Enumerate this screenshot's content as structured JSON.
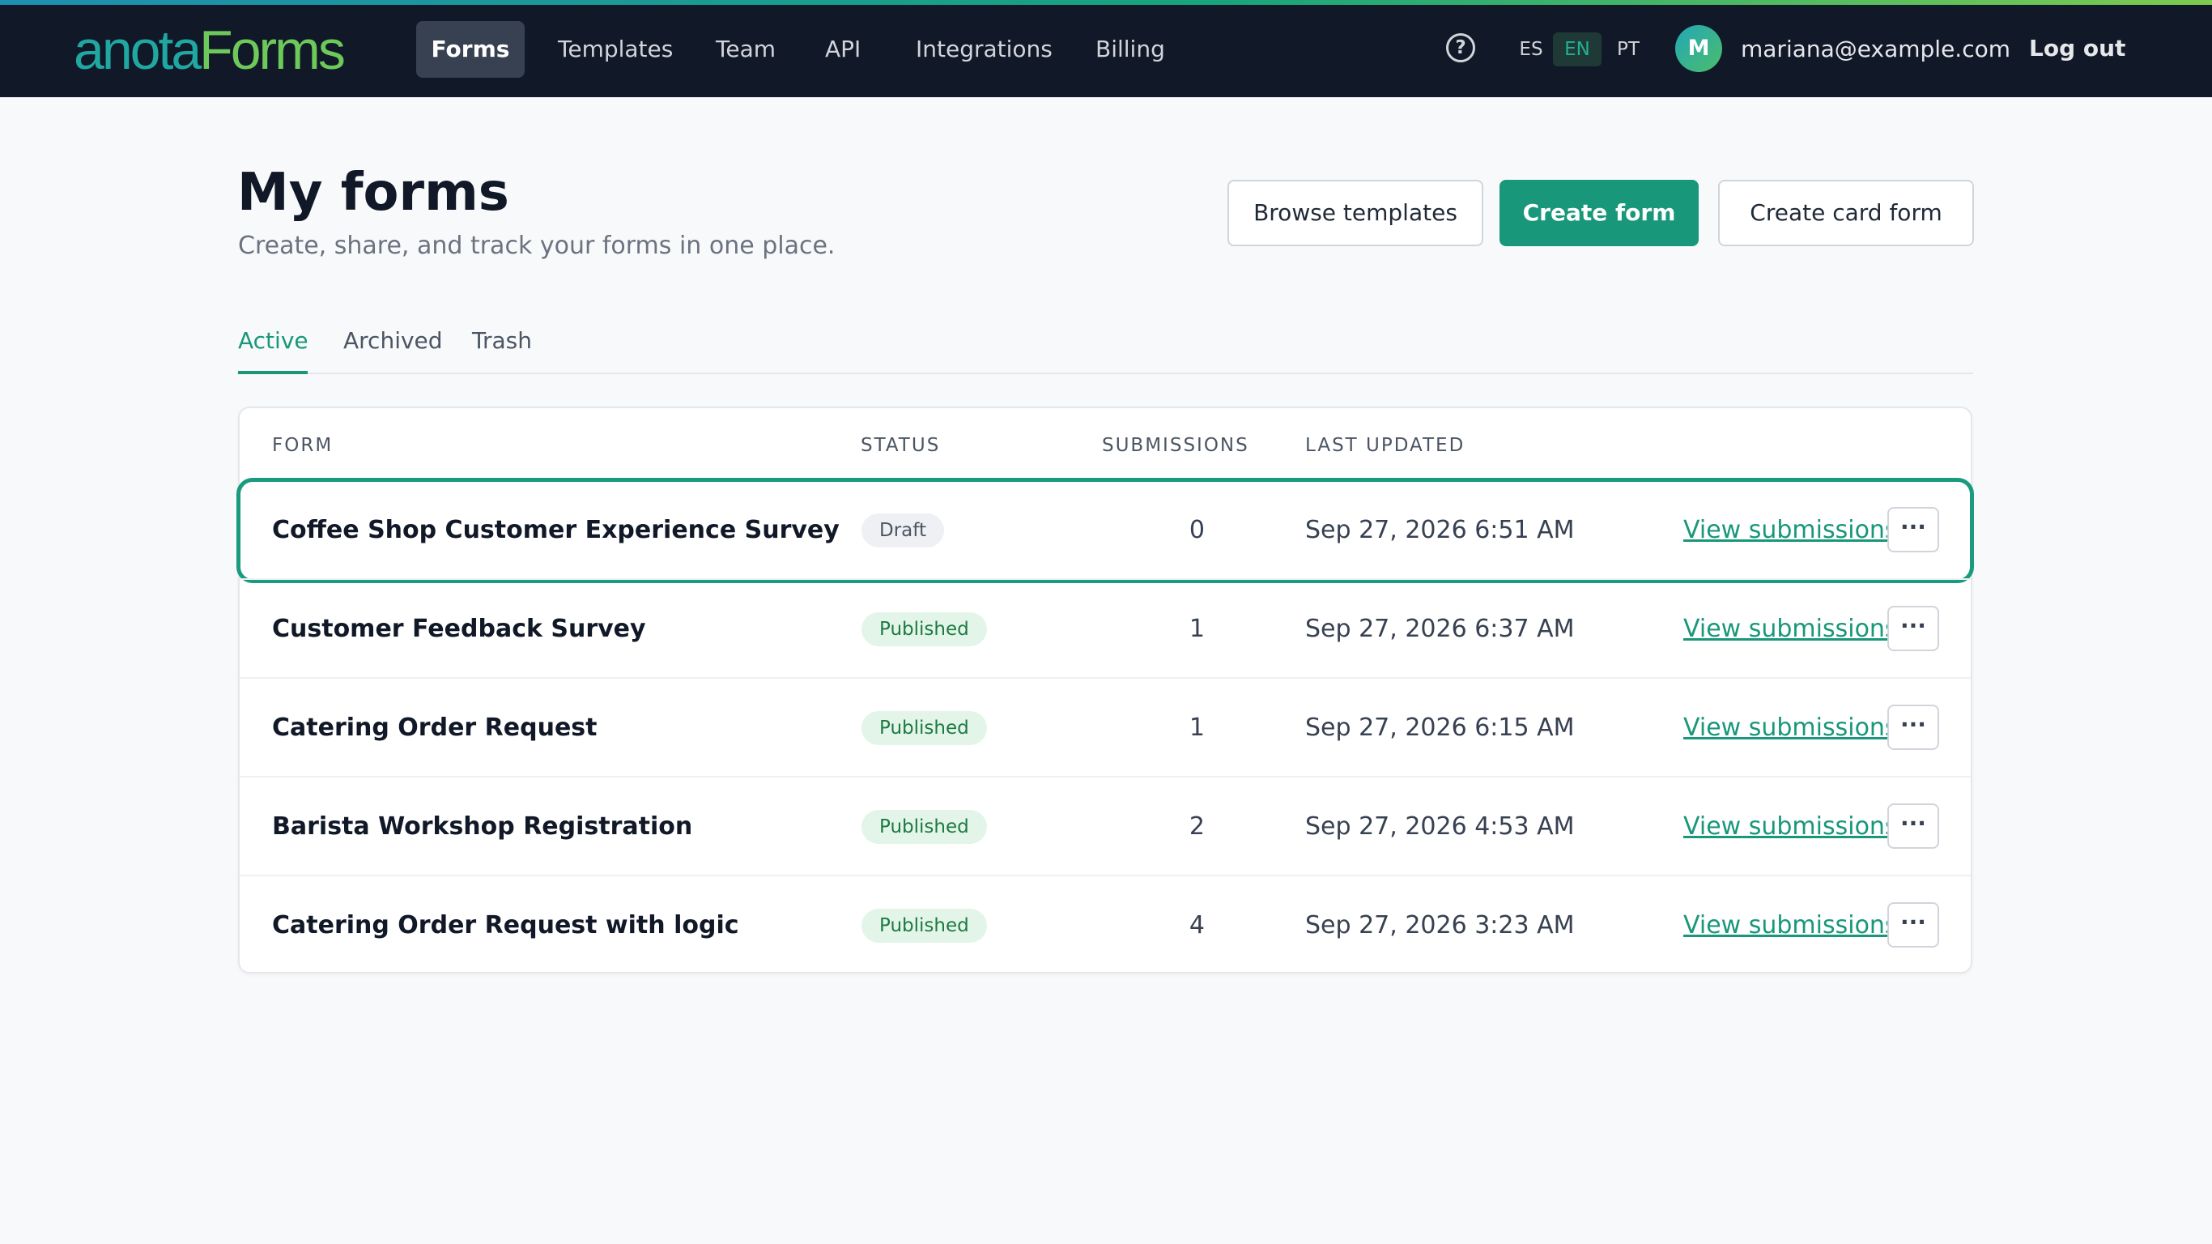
{
  "brand": {
    "logo_part1": "anota",
    "logo_part2": "Forms",
    "accent_color": "#18977a"
  },
  "nav": {
    "items": [
      {
        "label": "Forms",
        "active": true
      },
      {
        "label": "Templates",
        "active": false
      },
      {
        "label": "Team",
        "active": false
      },
      {
        "label": "API",
        "active": false
      },
      {
        "label": "Integrations",
        "active": false
      },
      {
        "label": "Billing",
        "active": false
      }
    ],
    "help_icon": "help-circle-icon",
    "help_glyph": "?",
    "languages": [
      {
        "code": "ES",
        "active": false
      },
      {
        "code": "EN",
        "active": true
      },
      {
        "code": "PT",
        "active": false
      }
    ],
    "user": {
      "initial": "M",
      "email": "mariana@example.com"
    },
    "logout_label": "Log out"
  },
  "page": {
    "title": "My forms",
    "subtitle": "Create, share, and track your forms in one place.",
    "actions": {
      "browse_templates": "Browse templates",
      "create_form": "Create form",
      "create_card_form": "Create card form"
    }
  },
  "tabs": [
    {
      "label": "Active",
      "active": true
    },
    {
      "label": "Archived",
      "active": false
    },
    {
      "label": "Trash",
      "active": false
    }
  ],
  "table": {
    "columns": {
      "form": "FORM",
      "status": "STATUS",
      "submissions": "SUBMISSIONS",
      "last_updated": "LAST UPDATED"
    },
    "rows": [
      {
        "name": "Coffee Shop Customer Experience Survey",
        "status": "Draft",
        "submissions": "0",
        "updated": "Sep 27, 2026 6:51 AM",
        "link": "View submissions",
        "more": "···",
        "highlighted": true
      },
      {
        "name": "Customer Feedback Survey",
        "status": "Published",
        "submissions": "1",
        "updated": "Sep 27, 2026 6:37 AM",
        "link": "View submissions",
        "more": "···",
        "highlighted": false
      },
      {
        "name": "Catering Order Request",
        "status": "Published",
        "submissions": "1",
        "updated": "Sep 27, 2026 6:15 AM",
        "link": "View submissions",
        "more": "···",
        "highlighted": false
      },
      {
        "name": "Barista Workshop Registration",
        "status": "Published",
        "submissions": "2",
        "updated": "Sep 27, 2026 4:53 AM",
        "link": "View submissions",
        "more": "···",
        "highlighted": false
      },
      {
        "name": "Catering Order Request with logic",
        "status": "Published",
        "submissions": "4",
        "updated": "Sep 27, 2026 3:23 AM",
        "link": "View submissions",
        "more": "···",
        "highlighted": false
      }
    ]
  }
}
